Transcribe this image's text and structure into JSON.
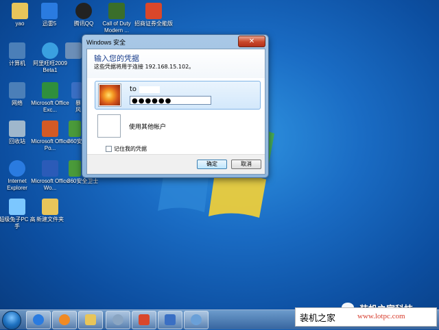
{
  "desktop": {
    "icons": [
      {
        "label": "yao",
        "icon": "folder-icon",
        "color": "#e8c55a"
      },
      {
        "label": "迅雷5",
        "icon": "thunder-icon",
        "color": "#2a7be0"
      },
      {
        "label": "腾讯QQ",
        "icon": "qq-icon",
        "color": "#222222"
      },
      {
        "label": "Call of Duty Modern ...",
        "icon": "game-icon",
        "color": "#3a6e2a"
      },
      {
        "label": "招商证券全能版",
        "icon": "stock-icon",
        "color": "#d9472b"
      },
      {
        "label": "计算机",
        "icon": "computer-icon",
        "color": "#4b7fb8"
      },
      {
        "label": "阿里旺旺2009 Beta1",
        "icon": "aliwangwang-icon",
        "color": "#3aa0e0"
      },
      {
        "label": "网络",
        "icon": "network-icon",
        "color": "#4b7fb8"
      },
      {
        "label": "Microsoft Office Exc...",
        "icon": "excel-icon",
        "color": "#2f8f3c"
      },
      {
        "label": "回收站",
        "icon": "recycle-bin-icon",
        "color": "#9fb7cc"
      },
      {
        "label": "Microsoft Office Po...",
        "icon": "powerpoint-icon",
        "color": "#d35a25"
      },
      {
        "label": "Internet Explorer",
        "icon": "ie-icon",
        "color": "#2a7be0"
      },
      {
        "label": "Microsoft Office Wo...",
        "icon": "word-icon",
        "color": "#2b5bb8"
      },
      {
        "label": "超级兔子PC 高手",
        "icon": "rabbit-icon",
        "color": "#7cc7ff"
      },
      {
        "label": "新建文件夹",
        "icon": "folder-icon",
        "color": "#e8c55a"
      }
    ],
    "partial_labels": [
      "暴风",
      "360安",
      "360安全卫士"
    ]
  },
  "dialog": {
    "title": "Windows 安全",
    "close_label": "✕",
    "heading": "输入您的凭据",
    "subheading": "这些凭据将用于连接 192.168.15.102。",
    "username": "to",
    "password_mask": "●●●●●●",
    "other_account_label": "使用其他帐户",
    "remember_label": "记住我的凭据",
    "ok_label": "确定",
    "cancel_label": "取消"
  },
  "taskbar": {
    "buttons": [
      {
        "name": "ie",
        "icon": "ie-icon",
        "color": "#2a7be0"
      },
      {
        "name": "media-player",
        "icon": "media-player-icon",
        "color": "#f08a24"
      },
      {
        "name": "explorer",
        "icon": "explorer-icon",
        "color": "#e8c55a"
      },
      {
        "name": "network-tool",
        "icon": "network-tool-icon",
        "color": "#8aa5c2"
      },
      {
        "name": "camera",
        "icon": "camera-icon",
        "color": "#d9472b"
      },
      {
        "name": "remote",
        "icon": "remote-desktop-icon",
        "color": "#3a6fc4"
      },
      {
        "name": "paint",
        "icon": "paint-icon",
        "color": "#6aa0d8"
      }
    ]
  },
  "watermark": {
    "brand": "装机之家科技",
    "cn": "装机之家",
    "url": "www.lotpc.com"
  }
}
